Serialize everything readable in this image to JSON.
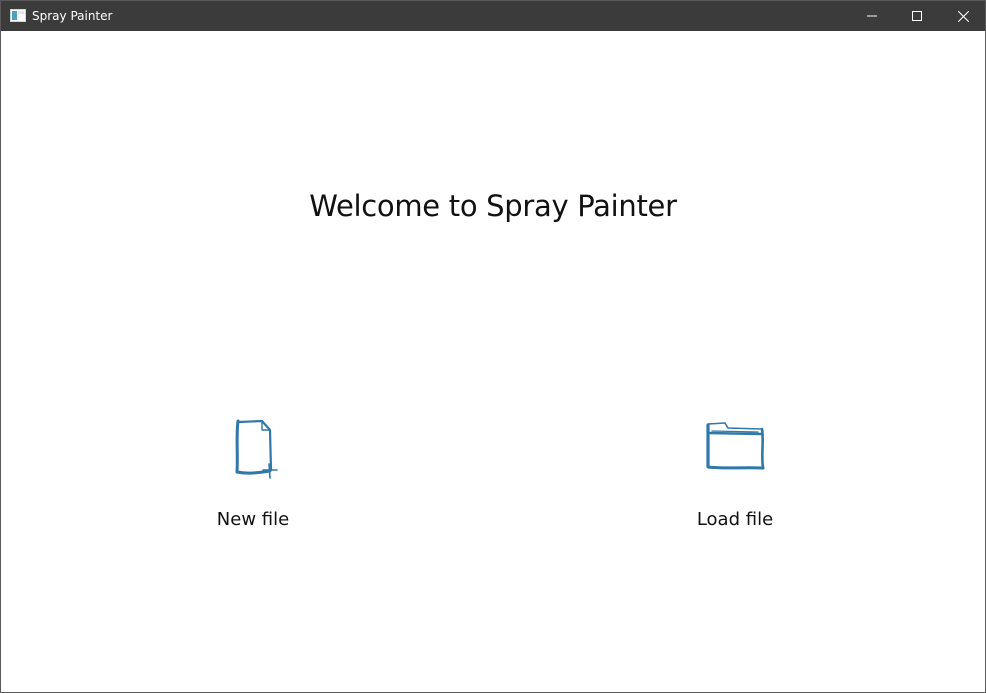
{
  "window": {
    "title": "Spray Painter",
    "icons": {
      "app": "app-icon",
      "minimize": "minimize-icon",
      "maximize": "maximize-icon",
      "close": "close-icon"
    }
  },
  "main": {
    "welcome": "Welcome to Spray Painter",
    "actions": [
      {
        "label": "New file",
        "icon": "new-file-icon"
      },
      {
        "label": "Load file",
        "icon": "folder-icon"
      }
    ]
  },
  "colors": {
    "titlebar_bg": "#3b3b3b",
    "content_bg": "#ffffff",
    "icon_stroke": "#2f78a8",
    "text": "#111111"
  }
}
